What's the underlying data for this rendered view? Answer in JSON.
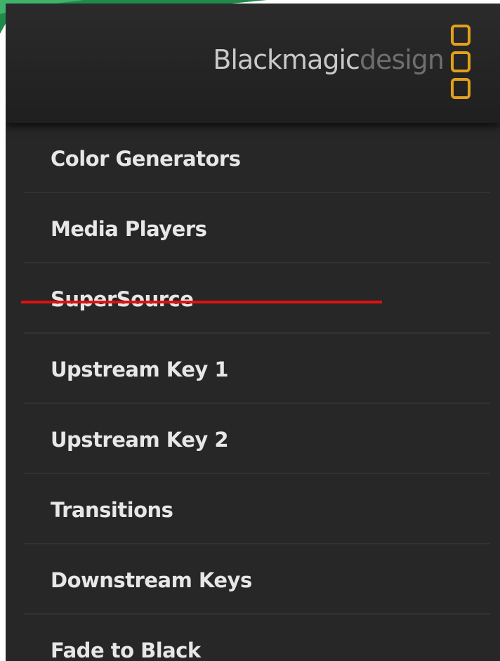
{
  "brand": {
    "name_main": "Blackmagic",
    "name_sub": "design",
    "accent_color": "#e3a01b",
    "logo_icon": "three-stacked-squares-icon"
  },
  "menu": {
    "items": [
      {
        "label": "Color Generators"
      },
      {
        "label": "Media Players"
      },
      {
        "label": "SuperSource",
        "struck_through": true
      },
      {
        "label": "Upstream Key 1"
      },
      {
        "label": "Upstream Key 2"
      },
      {
        "label": "Transitions"
      },
      {
        "label": "Downstream Keys"
      },
      {
        "label": "Fade to Black"
      }
    ]
  },
  "annotation": {
    "strike_color": "#e21010"
  }
}
